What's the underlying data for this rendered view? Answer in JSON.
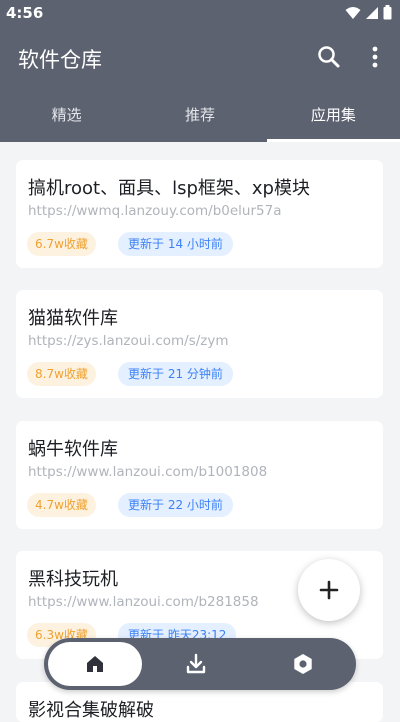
{
  "status": {
    "time": "4:56"
  },
  "app": {
    "title": "软件仓库"
  },
  "tabs": [
    {
      "label": "精选",
      "active": false
    },
    {
      "label": "推荐",
      "active": false
    },
    {
      "label": "应用集",
      "active": true
    }
  ],
  "cards": [
    {
      "title": "搞机root、面具、lsp框架、xp模块",
      "url": "https://wwmq.lanzouy.com/b0elur57a",
      "favorites": "6.7w收藏",
      "updated": "更新于 14 小时前"
    },
    {
      "title": "猫猫软件库",
      "url": "https://zys.lanzoui.com/s/zym",
      "favorites": "8.7w收藏",
      "updated": "更新于 21 分钟前"
    },
    {
      "title": "蜗牛软件库",
      "url": "https://www.lanzoui.com/b1001808",
      "favorites": "4.7w收藏",
      "updated": "更新于 22 小时前"
    },
    {
      "title": "黑科技玩机",
      "url": "https://www.lanzoui.com/b281858",
      "favorites": "6.3w收藏",
      "updated": "更新于 昨天23:12"
    },
    {
      "title": "影视合集破解破",
      "url": "",
      "favorites": "",
      "updated": ""
    }
  ],
  "fab": {
    "icon": "plus-icon"
  },
  "bottom_nav": [
    {
      "icon": "home-icon",
      "active": true
    },
    {
      "icon": "download-icon",
      "active": false
    },
    {
      "icon": "settings-icon",
      "active": false
    }
  ],
  "colors": {
    "header": "#5d6270",
    "background": "#f3f4f6",
    "favorite_badge_text": "#f0a12e",
    "favorite_badge_bg": "#fdf2e0",
    "update_badge_text": "#3c82f6",
    "update_badge_bg": "#e4efff"
  }
}
